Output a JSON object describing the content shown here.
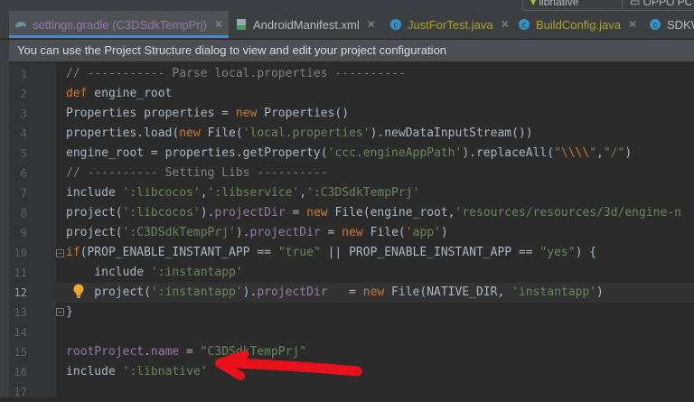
{
  "toolbar": {
    "config_label": "libnative",
    "device_label": "OPPO PC"
  },
  "tabs": [
    {
      "label": "settings.gradle (C3DSdkTempPrj)",
      "active": true,
      "icon": "gradle-icon"
    },
    {
      "label": "AndroidManifest.xml",
      "icon": "xml-manifest-icon"
    },
    {
      "label": "JustForTest.java",
      "icon": "java-class-icon"
    },
    {
      "label": "BuildConfig.java",
      "icon": "java-class-icon"
    },
    {
      "label": "SDKW",
      "icon": "java-class-icon"
    }
  ],
  "banner": {
    "text": "You can use the Project Structure dialog to view and edit your project configuration"
  },
  "editor": {
    "current_line": 12,
    "line_numbers": [
      "1",
      "2",
      "3",
      "4",
      "5",
      "6",
      "7",
      "8",
      "9",
      "10",
      "11",
      "12",
      "13",
      "14",
      "15",
      "16",
      "17"
    ],
    "lines": [
      [
        {
          "t": "// ----------- Parse local.properties ----------",
          "c": "com"
        }
      ],
      [
        {
          "t": "def",
          "c": "kw"
        },
        {
          "t": " engine_root"
        }
      ],
      [
        {
          "t": "Properties properties = "
        },
        {
          "t": "new",
          "c": "kw"
        },
        {
          "t": " Properties()"
        }
      ],
      [
        {
          "t": "properties.load("
        },
        {
          "t": "new",
          "c": "kw"
        },
        {
          "t": " File("
        },
        {
          "t": "'local.properties'",
          "c": "str"
        },
        {
          "t": ").newDataInputStream())"
        }
      ],
      [
        {
          "t": "engine_root = properties.getProperty("
        },
        {
          "t": "'ccc.engineAppPath'",
          "c": "str"
        },
        {
          "t": ").replaceAll("
        },
        {
          "t": "\"",
          "c": "str"
        },
        {
          "t": "\\\\\\\\",
          "c": "esc"
        },
        {
          "t": "\"",
          "c": "str"
        },
        {
          "t": ","
        },
        {
          "t": "\"/\"",
          "c": "str"
        },
        {
          "t": ")"
        }
      ],
      [
        {
          "t": "// ---------- Setting Libs ----------",
          "c": "com"
        }
      ],
      [
        {
          "t": "include "
        },
        {
          "t": "':libcocos'",
          "c": "str"
        },
        {
          "t": ","
        },
        {
          "t": "':libservice'",
          "c": "str"
        },
        {
          "t": ","
        },
        {
          "t": "':C3DSdkTempPrj'",
          "c": "str"
        }
      ],
      [
        {
          "t": "project("
        },
        {
          "t": "':libcocos'",
          "c": "str"
        },
        {
          "t": ")."
        },
        {
          "t": "projectDir",
          "c": "prop"
        },
        {
          "t": " = "
        },
        {
          "t": "new",
          "c": "kw"
        },
        {
          "t": " File(engine_root,"
        },
        {
          "t": "'resources/resources/3d/engine-n",
          "c": "str"
        }
      ],
      [
        {
          "t": "project("
        },
        {
          "t": "':C3DSdkTempPrj'",
          "c": "str"
        },
        {
          "t": ")."
        },
        {
          "t": "projectDir",
          "c": "prop"
        },
        {
          "t": " = "
        },
        {
          "t": "new",
          "c": "kw"
        },
        {
          "t": " File("
        },
        {
          "t": "'app'",
          "c": "str"
        },
        {
          "t": ")"
        }
      ],
      [
        {
          "t": "if",
          "c": "kw"
        },
        {
          "t": "(PROP_ENABLE_INSTANT_APP == "
        },
        {
          "t": "\"true\"",
          "c": "str"
        },
        {
          "t": " || PROP_ENABLE_INSTANT_APP == "
        },
        {
          "t": "\"yes\"",
          "c": "str"
        },
        {
          "t": ") {"
        }
      ],
      [
        {
          "t": "    include "
        },
        {
          "t": "':instantapp'",
          "c": "str"
        }
      ],
      [
        {
          "t": "    project("
        },
        {
          "t": "':instantapp'",
          "c": "str"
        },
        {
          "t": ")."
        },
        {
          "t": "projectDir",
          "c": "prop"
        },
        {
          "t": "   = "
        },
        {
          "t": "new",
          "c": "kw"
        },
        {
          "t": " File(NATIVE_DIR, "
        },
        {
          "t": "'instantapp'",
          "c": "str"
        },
        {
          "t": ")"
        }
      ],
      [
        {
          "t": "}"
        }
      ],
      [
        {
          "t": ""
        }
      ],
      [
        {
          "t": "rootProject",
          "c": "prop"
        },
        {
          "t": "."
        },
        {
          "t": "name",
          "c": "prop"
        },
        {
          "t": " = "
        },
        {
          "t": "\"C3DSdkTempPrj\"",
          "c": "str"
        }
      ],
      [
        {
          "t": "include "
        },
        {
          "t": "':libnative'",
          "c": "str"
        }
      ],
      [
        {
          "t": ""
        }
      ]
    ]
  },
  "colors": {
    "background": "#2b2b2b",
    "keyword": "#cc7832",
    "string": "#6a8759",
    "comment": "#808080",
    "property": "#9876aa",
    "annotation_arrow": "#e8111b"
  }
}
